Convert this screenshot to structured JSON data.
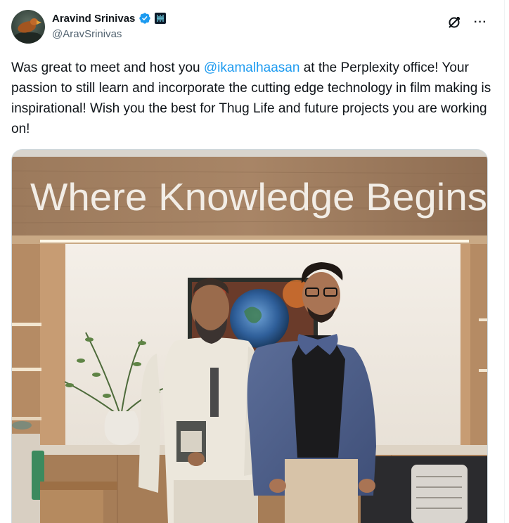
{
  "author": {
    "display_name": "Aravind Srinivas",
    "handle": "@AravSrinivas",
    "verified": true
  },
  "tweet": {
    "text_before": "Was great to meet and host you ",
    "mention": "@ikamalhaasan",
    "text_after": " at the Perplexity office! Your passion to still learn and incorporate the cutting edge technology in film making is inspirational! Wish you the best for Thug Life and future projects you are working on!"
  },
  "media": {
    "wall_sign": "Where Knowledge Begins"
  },
  "colors": {
    "link": "#1d9bf0",
    "verified": "#1d9bf0",
    "secondary_text": "#536471"
  },
  "icons": [
    "verified-badge-icon",
    "affiliate-badge-icon",
    "grok-icon",
    "more-options-icon"
  ]
}
